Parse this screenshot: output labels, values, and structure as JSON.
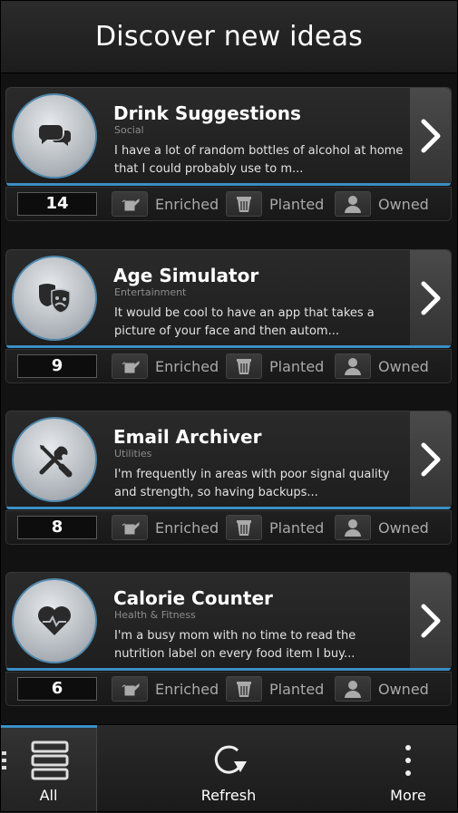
{
  "header": {
    "title": "Discover new ideas"
  },
  "ideas": [
    {
      "title": "Drink Suggestions",
      "category": "Social",
      "description": "I have a lot of random bottles of alcohol at home that I could probably use to m...",
      "count": "14",
      "icon": "speech-bubbles-icon"
    },
    {
      "title": "Age Simulator",
      "category": "Entertainment",
      "description": "It would be cool to have an app that takes a picture of your face and then autom...",
      "count": "9",
      "icon": "theater-masks-icon"
    },
    {
      "title": "Email Archiver",
      "category": "Utilities",
      "description": "I'm frequently in areas with poor signal quality and strength, so having backups...",
      "count": "8",
      "icon": "wrench-screwdriver-icon"
    },
    {
      "title": "Calorie Counter",
      "category": "Health & Fitness",
      "description": "I'm a busy mom with no time to read the nutrition label on every food item I buy...",
      "count": "6",
      "icon": "heart-pulse-icon"
    }
  ],
  "actions": {
    "enriched": "Enriched",
    "planted": "Planted",
    "owned": "Owned"
  },
  "footer": {
    "all": "All",
    "refresh": "Refresh",
    "more": "More"
  },
  "colors": {
    "accent": "#3a8fc4",
    "badge_ring": "#4f88ad"
  }
}
